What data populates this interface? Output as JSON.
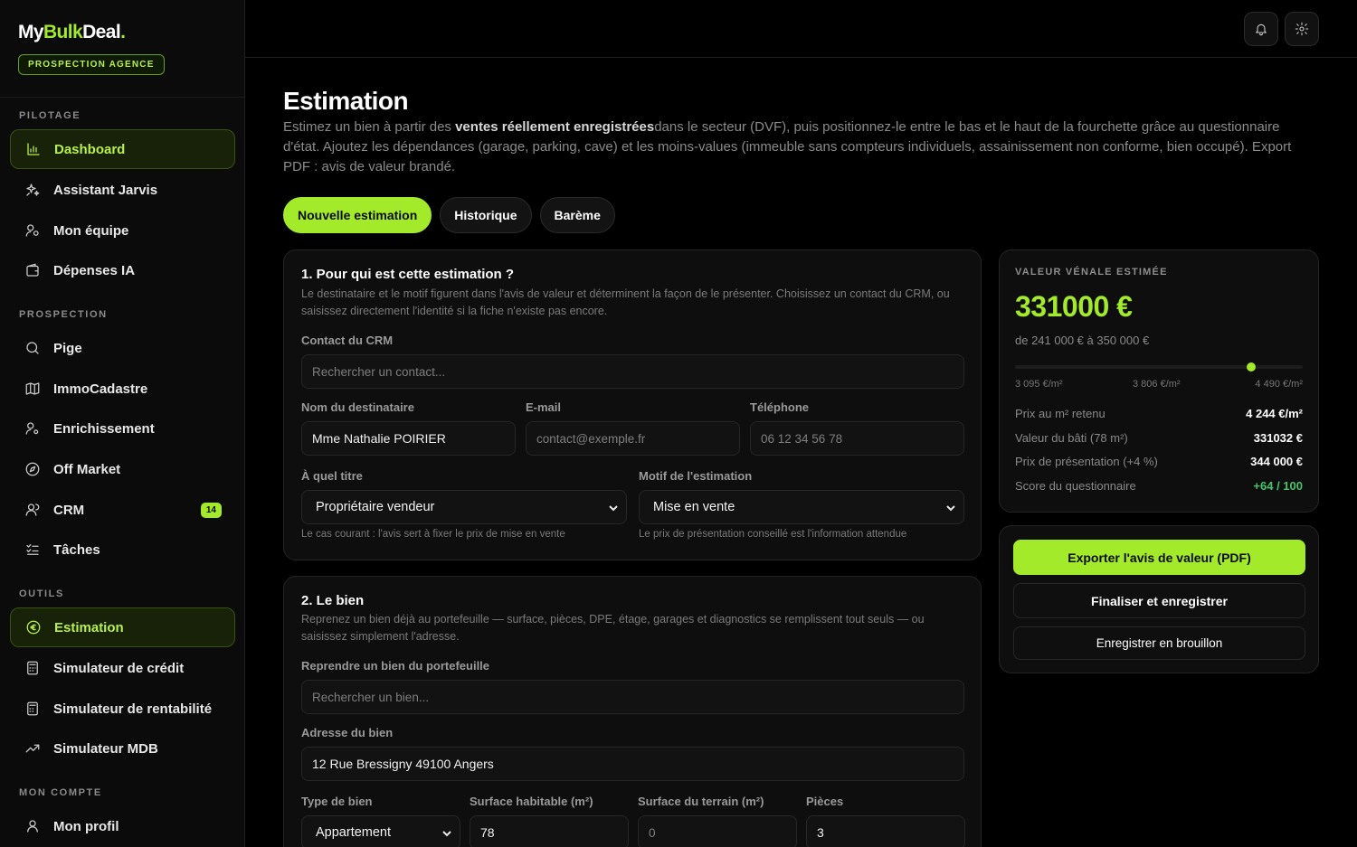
{
  "brand": {
    "logo_a": "My",
    "logo_b": "Bulk",
    "logo_c": "Deal",
    "logo_dot": ".",
    "tagline": "PROSPECTION AGENCE"
  },
  "sidebar": {
    "pilotage_label": "PILOTAGE",
    "pilotage": [
      {
        "label": "Dashboard",
        "icon": "chart-icon"
      },
      {
        "label": "Assistant Jarvis",
        "icon": "sparkles-icon"
      },
      {
        "label": "Mon équipe",
        "icon": "team-icon"
      },
      {
        "label": "Dépenses IA",
        "icon": "wallet-icon"
      }
    ],
    "prospection_label": "PROSPECTION",
    "prospection": [
      {
        "label": "Pige",
        "icon": "search-icon"
      },
      {
        "label": "ImmoCadastre",
        "icon": "map-icon"
      },
      {
        "label": "Enrichissement",
        "icon": "user-gear-icon"
      },
      {
        "label": "Off Market",
        "icon": "compass-icon"
      },
      {
        "label": "CRM",
        "icon": "users-icon",
        "badge": "14"
      },
      {
        "label": "Tâches",
        "icon": "checklist-icon"
      }
    ],
    "outils_label": "OUTILS",
    "outils": [
      {
        "label": "Estimation",
        "icon": "euro-icon"
      },
      {
        "label": "Simulateur de crédit",
        "icon": "calculator-icon"
      },
      {
        "label": "Simulateur de rentabilité",
        "icon": "calculator-icon"
      },
      {
        "label": "Simulateur MDB",
        "icon": "trend-icon"
      }
    ],
    "compte_label": "MON COMPTE",
    "compte": [
      {
        "label": "Mon profil",
        "icon": "user-icon"
      }
    ]
  },
  "page": {
    "title": "Estimation",
    "desc_a": "Estimez un bien à partir des ",
    "desc_b": "ventes réellement enregistrées",
    "desc_c": "dans le secteur (DVF), puis positionnez-le entre le bas et le haut de la fourchette grâce au questionnaire d'état. Ajoutez les dépendances (garage, parking, cave) et les moins-values (immeuble sans compteurs individuels, assainissement non conforme, bien occupé). Export PDF : avis de valeur brandé."
  },
  "tabs": [
    "Nouvelle estimation",
    "Historique",
    "Barème"
  ],
  "section1": {
    "title": "1. Pour qui est cette estimation ?",
    "subtitle": "Le destinataire et le motif figurent dans l'avis de valeur et déterminent la façon de le présenter. Choisissez un contact du CRM, ou saisissez directement l'identité si la fiche n'existe pas encore.",
    "crm_label": "Contact du CRM",
    "crm_placeholder": "Rechercher un contact...",
    "name_label": "Nom du destinataire",
    "name_value": "Mme Nathalie POIRIER",
    "email_label": "E-mail",
    "email_placeholder": "contact@exemple.fr",
    "phone_label": "Téléphone",
    "phone_placeholder": "06 12 34 56 78",
    "title_label": "À quel titre",
    "title_value": "Propriétaire vendeur",
    "title_hint": "Le cas courant : l'avis sert à fixer le prix de mise en vente",
    "motif_label": "Motif de l'estimation",
    "motif_value": "Mise en vente",
    "motif_hint": "Le prix de présentation conseillé est l'information attendue"
  },
  "section2": {
    "title": "2. Le bien",
    "subtitle": "Reprenez un bien déjà au portefeuille — surface, pièces, DPE, étage, garages et diagnostics se remplissent tout seuls — ou saisissez simplement l'adresse.",
    "portfolio_label": "Reprendre un bien du portefeuille",
    "portfolio_placeholder": "Rechercher un bien...",
    "address_label": "Adresse du bien",
    "address_value": "12 Rue Bressigny 49100 Angers",
    "type_label": "Type de bien",
    "type_value": "Appartement",
    "surface_label": "Surface habitable (m²)",
    "surface_value": "78",
    "terrain_label": "Surface du terrain (m²)",
    "terrain_placeholder": "0",
    "pieces_label": "Pièces",
    "pieces_value": "3"
  },
  "valuation": {
    "label": "VALEUR VÉNALE ESTIMÉE",
    "amount": "331000 €",
    "range": "de 241 000 € à 350 000 €",
    "position_fraction": 0.82,
    "tick_low": "3 095 €/m²",
    "tick_mid": "3 806 €/m²",
    "tick_high": "4 490 €/m²",
    "rows": [
      {
        "label": "Prix au m² retenu",
        "value": "4 244 €/m²"
      },
      {
        "label": "Valeur du bâti (78 m²)",
        "value": "331032 €"
      },
      {
        "label": "Prix de présentation (+4 %)",
        "value": "344 000 €"
      },
      {
        "label": "Score du questionnaire",
        "value": "+64 / 100"
      }
    ]
  },
  "actions": {
    "export": "Exporter l'avis de valeur (PDF)",
    "finalize": "Finaliser et enregistrer",
    "draft": "Enregistrer en brouillon"
  },
  "colors": {
    "accent": "#a3ea2a",
    "positive": "#46c46a",
    "background": "#000000"
  }
}
